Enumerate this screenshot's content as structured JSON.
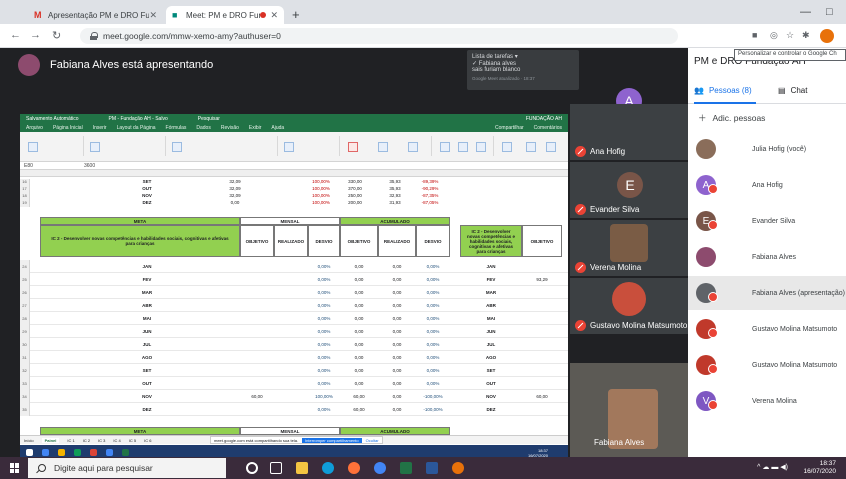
{
  "browser": {
    "tabs": [
      {
        "title": "Apresentação PM e DRO Fundaç",
        "favicon": "gmail-icon",
        "active": false
      },
      {
        "title": "Meet: PM e DRO Fundação",
        "favicon": "meet-icon",
        "active": true,
        "recording": true
      }
    ],
    "url": "meet.google.com/mmw-xemo-amy?authuser=0",
    "tooltip": "Personalizar e controlar o Google Ch"
  },
  "meet": {
    "presenting_text": "Fabiana Alves está apresentando",
    "meeting_title": "PM e DRO Fundação AH",
    "captions": {
      "line1": "Lista de tarefas ▾",
      "line2": "✓ Fabiana alves",
      "line3": "sais furiam blanco",
      "small": "Google Meet atualizado · 18:37"
    },
    "stage_avatar_letter": "A",
    "tiles": [
      {
        "name": "Ana Hofig",
        "letter": "",
        "kind": "avatar-purple"
      },
      {
        "name": "Evander Silva",
        "letter": "E",
        "kind": "letter"
      },
      {
        "name": "Verena Molina",
        "letter": "",
        "kind": "photo"
      },
      {
        "name": "Gustavo Molina Matsumoto",
        "letter": "",
        "kind": "photo"
      }
    ],
    "self_name": "Fabiana Alves"
  },
  "people_panel": {
    "tab_people": "Pessoas (8)",
    "tab_chat": "Chat",
    "add_people": "Adic. pessoas",
    "participants": [
      {
        "name": "Julia Hofig (você)",
        "letter": "",
        "color": "#8a6d5a",
        "muted": false
      },
      {
        "name": "Ana Hofig",
        "letter": "A",
        "color": "#8e63ce",
        "muted": true
      },
      {
        "name": "Evander Silva",
        "letter": "E",
        "color": "#795548",
        "muted": true
      },
      {
        "name": "Fabiana Alves",
        "letter": "",
        "color": "#8d4b6e",
        "muted": false
      },
      {
        "name": "Fabiana Alves (apresentação)",
        "letter": "",
        "color": "#5f6368",
        "muted": true
      },
      {
        "name": "Gustavo Molina Matsumoto",
        "letter": "",
        "color": "#c0392b",
        "muted": true
      },
      {
        "name": "Gustavo Molina Matsumoto",
        "letter": "",
        "color": "#c0392b",
        "muted": true
      },
      {
        "name": "Verena Molina",
        "letter": "V",
        "color": "#7e57c2",
        "muted": true
      }
    ]
  },
  "spreadsheet": {
    "app_title": "PM - Fundação AH - Salvo",
    "autosave": "Salvamento Automático",
    "search": "Pesquisar",
    "user": "FUNDAÇÃO AH",
    "menu": [
      "Arquivo",
      "Página Inicial",
      "Inserir",
      "Layout da Página",
      "Fórmulas",
      "Dados",
      "Revisão",
      "Exibir",
      "Ajuda"
    ],
    "share": "Compartilhar",
    "comments": "Comentários",
    "cell_ref": "E80",
    "formula": "3600",
    "top_rows": [
      {
        "row": "16",
        "month": "SET",
        "meta": "32,09",
        "pct": "100,00%",
        "a": "330,00",
        "b": "35,93",
        "c": "-89,39%"
      },
      {
        "row": "17",
        "month": "OUT",
        "meta": "32,09",
        "pct": "100,00%",
        "a": "370,00",
        "b": "35,93",
        "c": "-90,29%"
      },
      {
        "row": "18",
        "month": "NOV",
        "meta": "32,09",
        "pct": "100,00%",
        "a": "250,00",
        "b": "32,93",
        "c": "-87,35%"
      },
      {
        "row": "19",
        "month": "DEZ",
        "meta": "0,00",
        "pct": "100,00%",
        "a": "200,00",
        "b": "31,93",
        "c": "-87,05%"
      }
    ],
    "hdr_meta": "META",
    "hdr_mensal": "MENSAL",
    "hdr_acumulado": "ACUMULADO",
    "indicator": "IC 2 - Desenvolver novas competências e habilidades sociais, cognitivas e afetivas para crianças",
    "col_objetivo": "OBJETIVO",
    "col_realizado": "REALIZADO",
    "col_desvio": "DESVIO",
    "months": [
      {
        "row": "24",
        "m": "JAN",
        "obj": "",
        "desv": "0,00%",
        "ao": "0,00",
        "ar": "0,00",
        "ad": "0,00%",
        "robj": ""
      },
      {
        "row": "25",
        "m": "FEV",
        "obj": "",
        "desv": "0,00%",
        "ao": "0,00",
        "ar": "0,00",
        "ad": "0,00%",
        "robj": "93,29"
      },
      {
        "row": "26",
        "m": "MAR",
        "obj": "",
        "desv": "0,00%",
        "ao": "0,00",
        "ar": "0,00",
        "ad": "0,00%",
        "robj": ""
      },
      {
        "row": "27",
        "m": "ABR",
        "obj": "",
        "desv": "0,00%",
        "ao": "0,00",
        "ar": "0,00",
        "ad": "0,00%",
        "robj": ""
      },
      {
        "row": "28",
        "m": "MAI",
        "obj": "",
        "desv": "0,00%",
        "ao": "0,00",
        "ar": "0,00",
        "ad": "0,00%",
        "robj": ""
      },
      {
        "row": "29",
        "m": "JUN",
        "obj": "",
        "desv": "0,00%",
        "ao": "0,00",
        "ar": "0,00",
        "ad": "0,00%",
        "robj": ""
      },
      {
        "row": "30",
        "m": "JUL",
        "obj": "",
        "desv": "0,00%",
        "ao": "0,00",
        "ar": "0,00",
        "ad": "0,00%",
        "robj": ""
      },
      {
        "row": "31",
        "m": "AGO",
        "obj": "",
        "desv": "0,00%",
        "ao": "0,00",
        "ar": "0,00",
        "ad": "0,00%",
        "robj": ""
      },
      {
        "row": "32",
        "m": "SET",
        "obj": "",
        "desv": "0,00%",
        "ao": "0,00",
        "ar": "0,00",
        "ad": "0,00%",
        "robj": ""
      },
      {
        "row": "33",
        "m": "OUT",
        "obj": "",
        "desv": "0,00%",
        "ao": "0,00",
        "ar": "0,00",
        "ad": "0,00%",
        "robj": ""
      },
      {
        "row": "34",
        "m": "NOV",
        "obj": "60,00",
        "desv": "100,00%",
        "ao": "60,00",
        "ar": "0,00",
        "ad": "-100,00%",
        "robj": "60,00"
      },
      {
        "row": "35",
        "m": "DEZ",
        "obj": "",
        "desv": "0,00%",
        "ao": "60,00",
        "ar": "0,00",
        "ad": "-100,00%",
        "robj": ""
      }
    ],
    "sheet_tabs": [
      "Início",
      "Painel",
      "IC 1",
      "IC 2",
      "IC 3",
      "IC 4",
      "IC 5",
      "IC 6",
      "Equipe"
    ],
    "active_sheet": "Painel",
    "share_msg": "meet.google.com está compartilhando sua tela.",
    "share_stop": "Interromper compartilhamento",
    "share_hide": "Ocultar",
    "inner_time": "18:37",
    "inner_date": "16/07/2020"
  },
  "taskbar": {
    "search_placeholder": "Digite aqui para pesquisar",
    "time": "18:37",
    "date": "16/07/2020"
  }
}
